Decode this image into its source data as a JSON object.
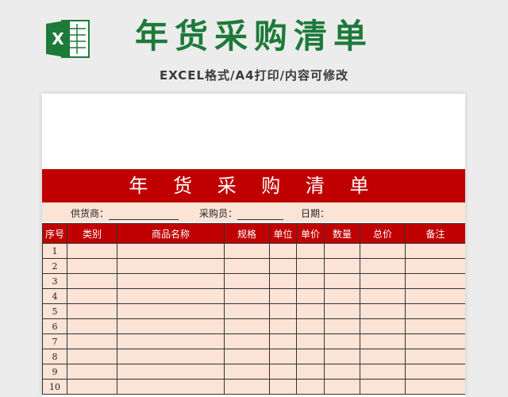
{
  "header": {
    "title": "年货采购清单",
    "subtitle": "EXCEL格式/A4打印/内容可修改",
    "logo_letter": "X"
  },
  "sheet": {
    "banner_title": "年 货 采 购 清 单",
    "info": {
      "supplier_label": "供货商：",
      "buyer_label": "采购员：",
      "date_label": "日期："
    },
    "columns": [
      "序号",
      "类别",
      "商品名称",
      "规格",
      "单位",
      "单价",
      "数量",
      "总价",
      "备注"
    ],
    "rows": [
      "1",
      "2",
      "3",
      "4",
      "5",
      "6",
      "7",
      "8",
      "9",
      "10"
    ]
  },
  "colors": {
    "brand_green": "#1d7a3a",
    "banner_red": "#c00000",
    "cell_fill": "#fbe3d6"
  },
  "icons": {
    "logo": "excel-icon"
  }
}
